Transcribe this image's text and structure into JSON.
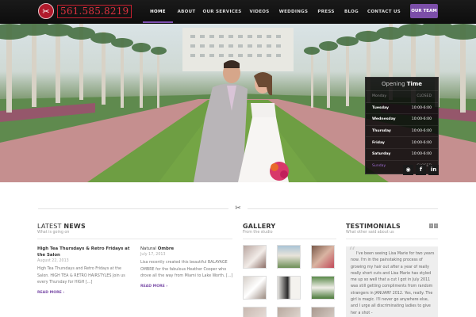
{
  "header": {
    "logo_phone": "561.585.8219",
    "logo_icon": "scissors-badge-icon",
    "nav": [
      "HOME",
      "ABOUT",
      "OUR SERVICES",
      "VIDEOS",
      "WEDDINGS",
      "PRESS",
      "BLOG",
      "CONTACT US"
    ],
    "active_nav": "HOME",
    "team_button": "OUR TEAM",
    "accent_color": "#7b4ea8"
  },
  "hours": {
    "title_prefix": "Opening",
    "title_emphasis": "Time",
    "rows": [
      {
        "day": "Monday",
        "time": "CLOSED"
      },
      {
        "day": "Tuesday",
        "time": "10:00-6:00"
      },
      {
        "day": "Wednesday",
        "time": "10:00-6:00"
      },
      {
        "day": "Thursday",
        "time": "10:00-6:00"
      },
      {
        "day": "Friday",
        "time": "10:00-6:00"
      },
      {
        "day": "Saturday",
        "time": "10:00-6:00"
      },
      {
        "day": "Sunday",
        "time": "CLOSED"
      }
    ]
  },
  "social": [
    "rss-icon",
    "facebook-icon",
    "linkedin-icon"
  ],
  "news": {
    "title_light": "LATEST",
    "title_bold": "NEWS",
    "subtitle": "What is going on",
    "posts": [
      {
        "title": "High Tea Thursdays & Retro Fridays at the Salon",
        "date": "August 22, 2013",
        "excerpt": "High Tea Thursdays and Retro Fridays at the Salon. HIGH TEA & RETRO HAIRSTYLES Join us every Thursday for HIGH [...]",
        "more": "READ MORE ›"
      },
      {
        "title_light": "Natural",
        "title_bold": "Ombre",
        "date": "July 17, 2013",
        "excerpt": "Lisa recently created this beautiful BALAYAGE OMBRE for the fabulous Heather Cooper who drove all the way from Miami to Lake Worth. [...]",
        "more": "READ MORE ›"
      }
    ]
  },
  "gallery": {
    "title": "GALLERY",
    "subtitle": "From the studio"
  },
  "testimonials": {
    "title": "TESTIMONIALS",
    "subtitle": "What other said about us",
    "text": "I've been seeing Lisa Marie for two years now. I'm in the painstaking process of growing my hair out after a year of really really short cuts and Lisa Marie has styled me up so well that a cut I got in July 2011 was still getting compliments from random strangers in JANUARY 2012. Yes, really. The girl is magic. I'll never go anywhere else, and I urge all discriminating ladies to give her a shot -"
  }
}
